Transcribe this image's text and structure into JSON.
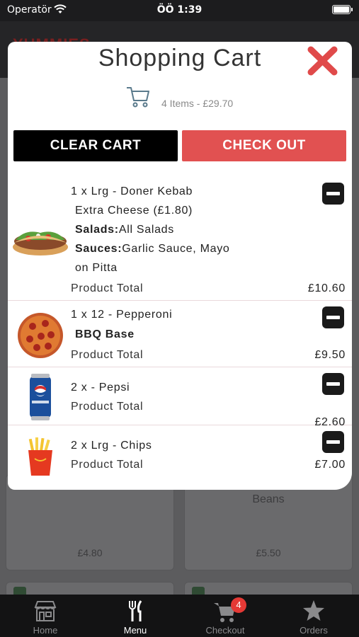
{
  "status_bar": {
    "carrier": "Operatör",
    "time": "ÖÖ 1:39"
  },
  "background": {
    "logo": "YUMMIES",
    "cards": [
      {
        "text": "£4.80"
      },
      {
        "text": "Beans"
      },
      {
        "text": "£5.50"
      }
    ]
  },
  "cart": {
    "title": "Shopping Cart",
    "summary": "4 Items - £29.70",
    "clear_label": "CLEAR CART",
    "checkout_label": "CHECK OUT",
    "items": [
      {
        "name": "1 x Lrg - Doner Kebab",
        "option1": "Extra Cheese (£1.80)",
        "salads_label": "Salads:",
        "salads_value": "All Salads",
        "sauces_label": "Sauces:",
        "sauces_value": "Garlic Sauce, Mayo",
        "option2": "on Pitta",
        "total_label": "Product Total",
        "price": "£10.60"
      },
      {
        "name": "1 x 12 - Pepperoni",
        "option1": "BBQ Base",
        "total_label": "Product Total",
        "price": "£9.50"
      },
      {
        "name": "2 x - Pepsi",
        "total_label": "Product Total",
        "price": "£2.60"
      },
      {
        "name": "2 x Lrg - Chips",
        "total_label": "Product Total",
        "price": "£7.00"
      }
    ]
  },
  "tabs": [
    {
      "label": "Home",
      "icon": "store-icon"
    },
    {
      "label": "Menu",
      "icon": "cutlery-icon"
    },
    {
      "label": "Checkout",
      "icon": "cart-icon",
      "badge": "4"
    },
    {
      "label": "Orders",
      "icon": "star-icon"
    }
  ],
  "colors": {
    "accent": "#e15151",
    "close": "#e04a4a",
    "dark": "#000000"
  }
}
